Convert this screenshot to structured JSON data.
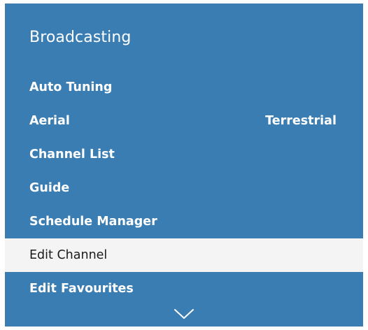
{
  "menu": {
    "title": "Broadcasting",
    "items": [
      {
        "label": "Auto Tuning",
        "value": ""
      },
      {
        "label": "Aerial",
        "value": "Terrestrial"
      },
      {
        "label": "Channel List",
        "value": ""
      },
      {
        "label": "Guide",
        "value": ""
      },
      {
        "label": "Schedule Manager",
        "value": ""
      },
      {
        "label": "Edit Channel",
        "value": "",
        "selected": true
      },
      {
        "label": "Edit Favourites",
        "value": ""
      }
    ],
    "scroll_icon": "chevron-down-icon"
  },
  "colors": {
    "panel_background": "#3a7db3",
    "selected_background": "#f4f4f4",
    "text": "#ffffff",
    "selected_text": "#1a1a1a"
  }
}
